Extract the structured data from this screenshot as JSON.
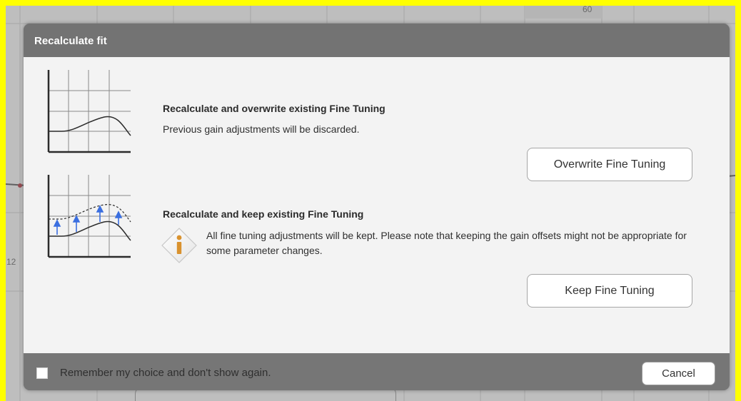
{
  "background": {
    "tick_top": "60",
    "tick_left": "12"
  },
  "dialog": {
    "title": "Recalculate fit",
    "options": [
      {
        "title": "Recalculate and overwrite existing Fine Tuning",
        "description": "Previous gain adjustments will be discarded.",
        "button_label": "Overwrite Fine Tuning"
      },
      {
        "title": "Recalculate and keep existing Fine Tuning",
        "description": "All fine tuning adjustments will be kept. Please note that keeping the gain offsets might not be appropriate for some parameter changes.",
        "button_label": "Keep Fine Tuning"
      }
    ],
    "footer": {
      "remember_label": "Remember my choice and don't show again.",
      "remember_checked": false,
      "cancel_label": "Cancel"
    }
  },
  "colors": {
    "frame": "#ffff00",
    "header": "#737373",
    "body": "#f3f3f3",
    "footer": "#767676",
    "curve": "#2b2b2b",
    "arrow": "#3b6fe0",
    "info_icon_orange": "#d9922e"
  },
  "icons": {
    "info": "info-icon"
  }
}
